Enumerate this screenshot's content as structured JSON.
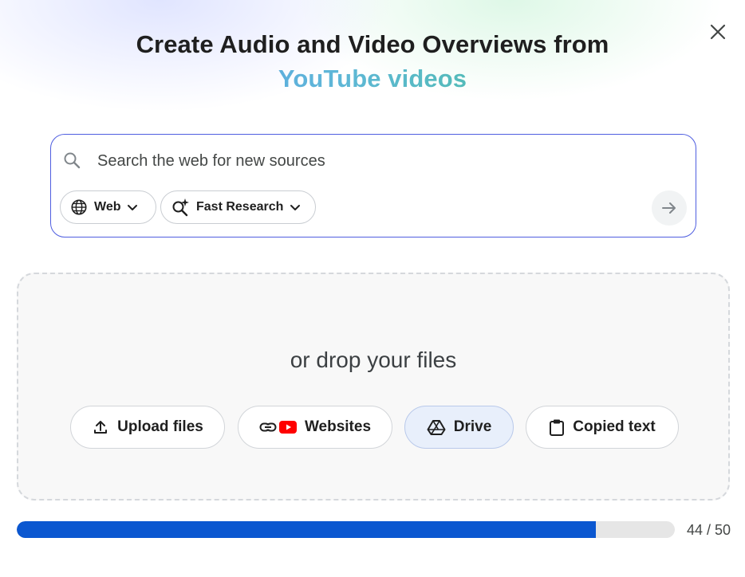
{
  "dialog": {
    "title_line1": "Create Audio and Video Overviews from",
    "title_line2": "YouTube videos",
    "close_icon": "close-icon"
  },
  "search": {
    "placeholder": "Search the web for new sources",
    "value": "",
    "source_chip_label": "Web",
    "mode_chip_label": "Fast Research",
    "accent_color": "#4f5ee0"
  },
  "drop_zone": {
    "text": "or drop your files",
    "buttons": [
      {
        "label": "Upload files",
        "icon": "upload-icon"
      },
      {
        "label": "Websites",
        "icon": "link-icon"
      },
      {
        "label": "Drive",
        "icon": "drive-icon"
      },
      {
        "label": "Copied text",
        "icon": "clipboard-icon"
      }
    ]
  },
  "source_limit": {
    "count_text": "44 / 50",
    "used": 44,
    "max": 50,
    "fill_color": "#0b57d0"
  }
}
